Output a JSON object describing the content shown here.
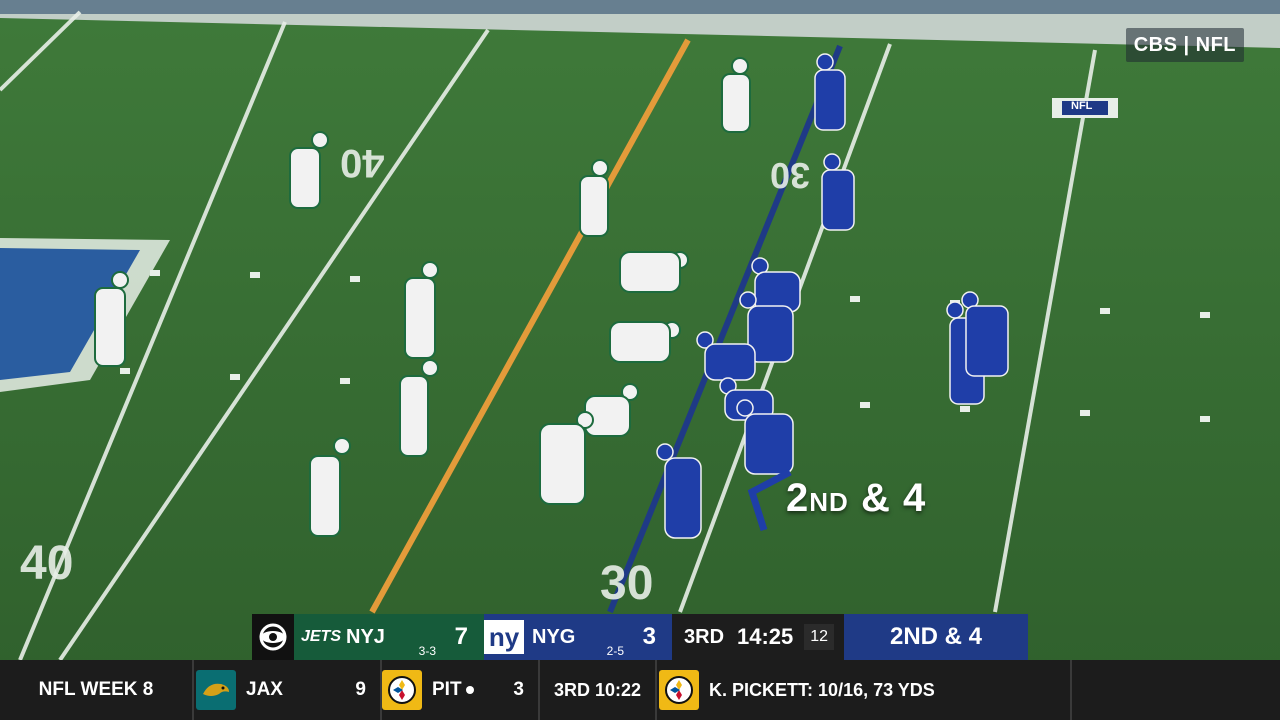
{
  "broadcast": {
    "network_bug": "CBS | NFL"
  },
  "field": {
    "yard_numbers": [
      "40",
      "30",
      "40",
      "30"
    ],
    "shield_logo": "NFL"
  },
  "overlay": {
    "down": "2",
    "down_suffix": "ND",
    "amp": "&",
    "distance": "4"
  },
  "scorebug": {
    "network": "CBS",
    "away": {
      "abbr": "NYJ",
      "score": "7",
      "record": "3-3",
      "color": "#165b3a",
      "logo_text": "JETS"
    },
    "home": {
      "abbr": "NYG",
      "score": "3",
      "record": "2-5",
      "color": "#1f3a86",
      "logo_text": "ny"
    },
    "quarter": "3RD",
    "clock": "14:25",
    "play_clock": "12",
    "down_distance": "2ND & 4"
  },
  "ticker": {
    "title": "NFL WEEK 8",
    "game": {
      "away": {
        "abbr": "JAX",
        "score": "9",
        "logo_color": "#0a6e72"
      },
      "home": {
        "abbr": "PIT",
        "score": "3",
        "logo_color": "#f0b915",
        "possession": true
      },
      "status": "3RD 10:22"
    },
    "stat": {
      "logo_color": "#f0b915",
      "text": "K. PICKETT: 10/16, 73 YDS"
    }
  }
}
